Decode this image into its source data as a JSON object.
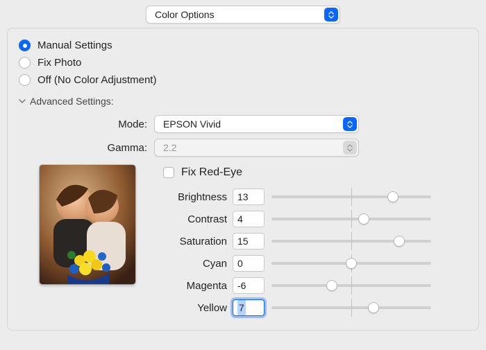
{
  "topSelect": {
    "label": "Color Options"
  },
  "radios": {
    "manual": "Manual Settings",
    "fixPhoto": "Fix Photo",
    "off": "Off (No Color Adjustment)",
    "selected": "manual"
  },
  "advanced": {
    "title": "Advanced Settings:",
    "modeLabel": "Mode:",
    "modeValue": "EPSON Vivid",
    "gammaLabel": "Gamma:",
    "gammaValue": "2.2",
    "fixRedEye": "Fix Red-Eye"
  },
  "sliders": {
    "range": {
      "min": -25,
      "max": 25
    },
    "brightness": {
      "label": "Brightness",
      "value": 13
    },
    "contrast": {
      "label": "Contrast",
      "value": 4
    },
    "saturation": {
      "label": "Saturation",
      "value": 15
    },
    "cyan": {
      "label": "Cyan",
      "value": 0
    },
    "magenta": {
      "label": "Magenta",
      "value": -6
    },
    "yellow": {
      "label": "Yellow",
      "value": 7,
      "focused": true
    }
  }
}
